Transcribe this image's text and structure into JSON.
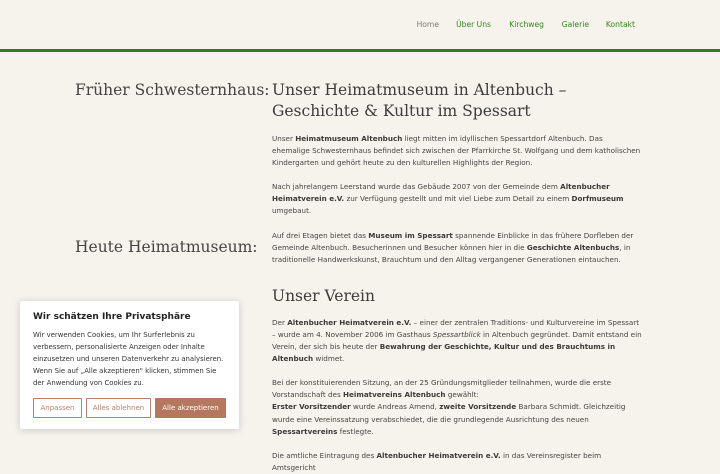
{
  "nav": {
    "items": [
      "Home",
      "Über Uns",
      "Kirchweg",
      "Galerie",
      "Kontakt"
    ],
    "active": "Home"
  },
  "sidebar": {
    "heading1": "Früher Schwesternhaus:",
    "heading2": "Heute Heimatmuseum:"
  },
  "section1": {
    "title": "Unser Heimatmuseum in Altenbuch – Geschichte & Kultur im Spessart",
    "p1": [
      {
        "t": "Unser "
      },
      {
        "t": "Heimatmuseum Altenbuch",
        "b": true
      },
      {
        "t": " liegt mitten im idyllischen Spessartdorf Altenbuch. Das ehemalige Schwesternhaus befindet sich zwischen der Pfarrkirche St. Wolfgang und dem katholischen Kindergarten und gehört heute zu den kulturellen Highlights der Region."
      }
    ],
    "p2": [
      {
        "t": "Nach jahrelangem Leerstand wurde das Gebäude 2007 von der Gemeinde dem "
      },
      {
        "t": "Altenbucher Heimatverein e.V.",
        "b": true
      },
      {
        "t": " zur Verfügung gestellt und mit viel Liebe zum Detail zu einem "
      },
      {
        "t": "Dorfmuseum",
        "b": true
      },
      {
        "t": " umgebaut."
      }
    ],
    "p3": [
      {
        "t": "Auf drei Etagen bietet das "
      },
      {
        "t": "Museum im Spessart",
        "b": true
      },
      {
        "t": " spannende Einblicke in das frühere Dorfleben der Gemeinde Altenbuch. Besucherinnen und Besucher können hier in die "
      },
      {
        "t": "Geschichte Altenbuchs",
        "b": true
      },
      {
        "t": ", in traditionelle Handwerkskunst, Brauchtum und den Alltag vergangener Generationen eintauchen."
      }
    ]
  },
  "section2": {
    "title": "Unser Verein",
    "p1": [
      {
        "t": "Der "
      },
      {
        "t": "Altenbucher Heimatverein e.V.",
        "b": true
      },
      {
        "t": " – einer der zentralen Traditions- und Kulturvereine im Spessart – wurde am 4. November 2006 im Gasthaus "
      },
      {
        "t": "Spessartblick",
        "i": true
      },
      {
        "t": " in Altenbuch gegründet. Damit entstand ein Verein, der sich bis heute der "
      },
      {
        "t": "Bewahrung der Geschichte, Kultur und des Brauchtums in Altenbuch",
        "b": true
      },
      {
        "t": " widmet."
      }
    ],
    "p2": [
      {
        "t": "Bei der konstituierenden Sitzung, an der 25 Gründungsmitglieder teilnahmen, wurde die erste Vorstandschaft des "
      },
      {
        "t": "Heimatvereins Altenbuch",
        "b": true
      },
      {
        "t": " gewählt:"
      },
      {
        "br": true
      },
      {
        "t": "Erster Vorsitzender",
        "b": true
      },
      {
        "t": " wurde Andreas Amend, "
      },
      {
        "t": "zweite Vorsitzende",
        "b": true
      },
      {
        "t": " Barbara Schmidt. Gleichzeitig wurde eine Vereinssatzung verabschiedet, die die grundlegende Ausrichtung des neuen "
      },
      {
        "t": "Spessartvereins",
        "b": true
      },
      {
        "t": " festlegte."
      }
    ],
    "p3": [
      {
        "t": "Die amtliche Eintragung des "
      },
      {
        "t": "Altenbucher Heimatverein e.V.",
        "b": true
      },
      {
        "t": " in das Vereinsregister beim Amtsgericht"
      }
    ]
  },
  "cookie": {
    "title": "Wir schätzen Ihre Privatsphäre",
    "text": "Wir verwenden Cookies, um Ihr Surferlebnis zu verbessern, personalisierte Anzeigen oder Inhalte einzusetzen und unseren Datenverkehr zu analysieren. Wenn Sie auf „Alle akzeptieren\" klicken, stimmen Sie der Anwendung von Cookies zu.",
    "btn_customize": "Anpassen",
    "btn_reject": "Alles ablehnen",
    "btn_accept": "Alle akzeptieren"
  },
  "colors": {
    "accent": "#2e7d1f",
    "nav_link": "#2e8a1b",
    "button": "#b5785f",
    "background": "#f6f3ec"
  }
}
